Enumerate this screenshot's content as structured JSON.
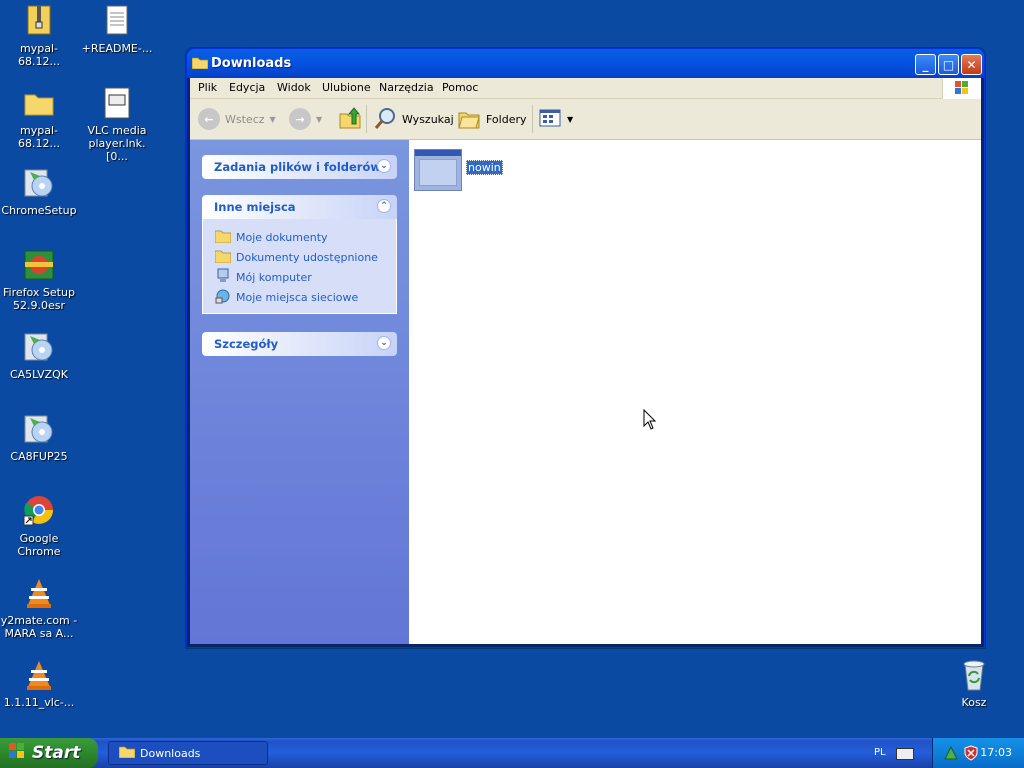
{
  "desktop": {
    "icons": [
      {
        "label": "mypal-68.12...",
        "icon": "zip-icon"
      },
      {
        "label": "+README-...",
        "icon": "text-file-icon"
      },
      {
        "label": "mypal-68.12...",
        "icon": "folder-icon"
      },
      {
        "label": "VLC media player.lnk.[0...",
        "icon": "file-icon"
      },
      {
        "label": "ChromeSetup",
        "icon": "installer-icon"
      },
      {
        "label": "Firefox Setup 52.9.0esr",
        "icon": "installer-icon"
      },
      {
        "label": "CA5LVZQK",
        "icon": "installer-icon"
      },
      {
        "label": "CA8FUP25",
        "icon": "installer-icon"
      },
      {
        "label": "Google Chrome",
        "icon": "chrome-icon"
      },
      {
        "label": "y2mate.com - MARA sa A...",
        "icon": "vlc-icon"
      },
      {
        "label": "1.1.11_vlc-...",
        "icon": "vlc-icon"
      },
      {
        "label": "Kosz",
        "icon": "recycle-bin-icon"
      }
    ]
  },
  "window": {
    "title": "Downloads",
    "menu": [
      "Plik",
      "Edycja",
      "Widok",
      "Ulubione",
      "Narzędzia",
      "Pomoc"
    ],
    "toolbar": {
      "back": "Wstecz",
      "search": "Wyszukaj",
      "folders": "Foldery"
    },
    "panels": {
      "tasks_title": "Zadania plików i folderów",
      "places_title": "Inne miejsca",
      "places": [
        "Moje dokumenty",
        "Dokumenty udostępnione",
        "Mój komputer",
        "Moje miejsca sieciowe"
      ],
      "details_title": "Szczegóły"
    },
    "files": [
      {
        "name": "nowin",
        "selected": true
      }
    ]
  },
  "taskbar": {
    "start": "Start",
    "task": "Downloads",
    "language": "PL",
    "clock": "17:03"
  },
  "colors": {
    "desktop": "#0b4aa3",
    "titlebar": "#0554e1",
    "taskpane_link": "#215dc6",
    "selection": "#316ac5"
  }
}
